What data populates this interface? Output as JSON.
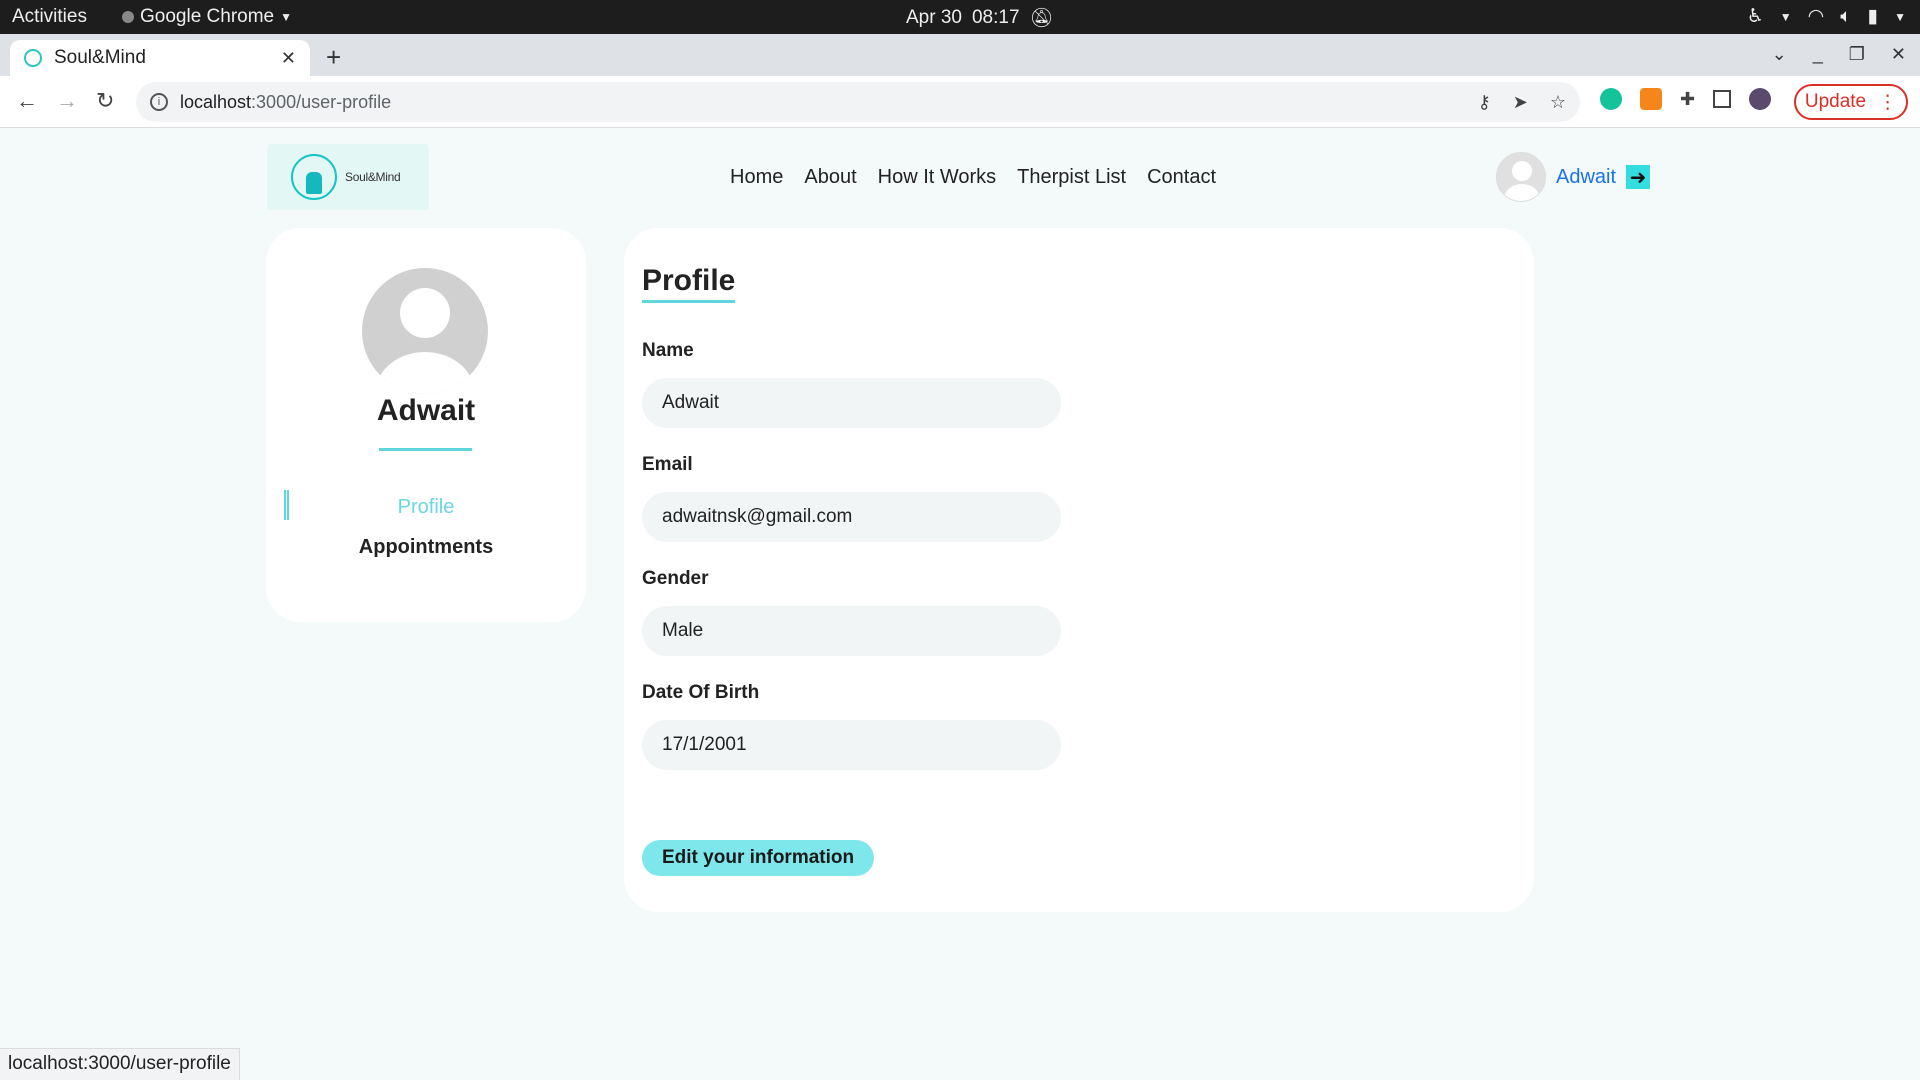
{
  "os": {
    "activities": "Activities",
    "app_name": "Google Chrome",
    "date": "Apr 30",
    "time": "08:17"
  },
  "browser": {
    "tab_title": "Soul&Mind",
    "url_host": "localhost",
    "url_path": ":3000/user-profile",
    "update_label": "Update",
    "status_url": "localhost:3000/user-profile"
  },
  "site": {
    "logo_text": "Soul&Mind",
    "nav": [
      "Home",
      "About",
      "How It Works",
      "Therpist List",
      "Contact"
    ],
    "user_name": "Adwait"
  },
  "sidebar": {
    "name": "Adwait",
    "items": [
      {
        "label": "Profile",
        "active": true
      },
      {
        "label": "Appointments",
        "active": false
      }
    ]
  },
  "profile": {
    "title": "Profile",
    "fields": [
      {
        "label": "Name",
        "value": "Adwait"
      },
      {
        "label": "Email",
        "value": "adwaitnsk@gmail.com"
      },
      {
        "label": "Gender",
        "value": "Male"
      },
      {
        "label": "Date Of Birth",
        "value": "17/1/2001"
      }
    ],
    "edit_button": "Edit your information"
  },
  "colors": {
    "accent": "#5fd5dd",
    "button": "#7ee7ec",
    "link": "#1a73e8",
    "update": "#d93025"
  }
}
